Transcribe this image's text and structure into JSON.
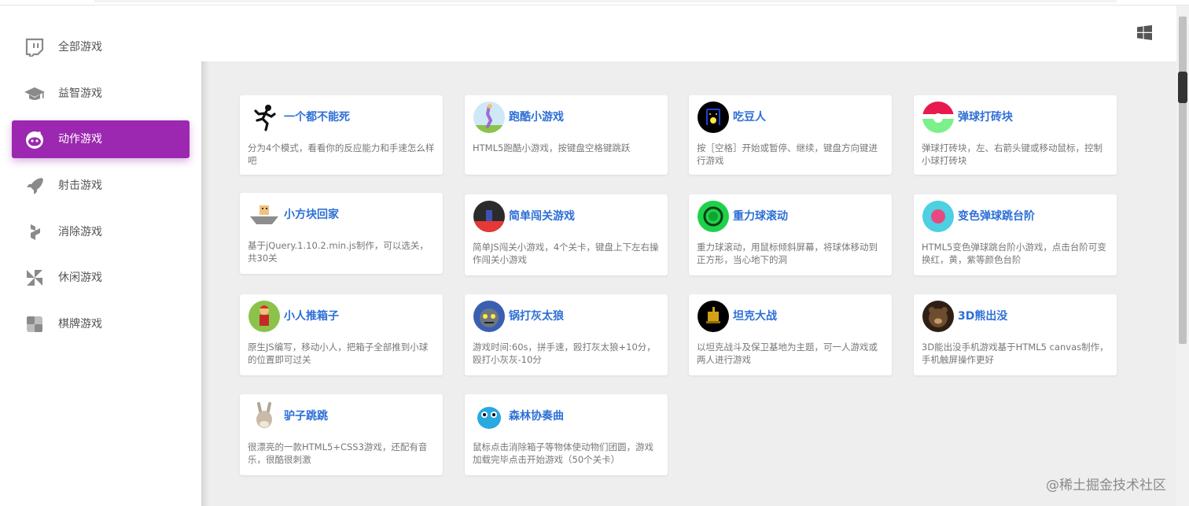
{
  "sidebar": {
    "items": [
      {
        "label": "全部游戏",
        "icon": "twitch-icon",
        "active": false
      },
      {
        "label": "益智游戏",
        "icon": "graduation-cap-icon",
        "active": false
      },
      {
        "label": "动作游戏",
        "icon": "reddit-icon",
        "active": true
      },
      {
        "label": "射击游戏",
        "icon": "rocket-icon",
        "active": false
      },
      {
        "label": "消除游戏",
        "icon": "hubspot-icon",
        "active": false
      },
      {
        "label": "休闲游戏",
        "icon": "pinwheel-icon",
        "active": false
      },
      {
        "label": "棋牌游戏",
        "icon": "board-icon",
        "active": false
      }
    ]
  },
  "header": {
    "right_icon": "windows-icon"
  },
  "colors": {
    "accent": "#9c27b0",
    "title": "#2d6fd6",
    "text": "#777777",
    "background": "#eeeeee"
  },
  "games": [
    {
      "title": "一个都不能死",
      "desc": "分为4个模式，看看你的反应能力和手速怎么样吧",
      "icon": "running-man-icon"
    },
    {
      "title": "跑酷小游戏",
      "desc": "HTML5跑酷小游戏，按键盘空格键跳跃",
      "icon": "parkour-icon"
    },
    {
      "title": "吃豆人",
      "desc": "按［空格］开始或暂停、继续，键盘方向键进行游戏",
      "icon": "pacman-icon"
    },
    {
      "title": "弹球打砖块",
      "desc": "弹球打砖块，左、右箭头键或移动鼠标，控制小球打砖块",
      "icon": "breakout-icon"
    },
    {
      "title": "小方块回家",
      "desc": "基于jQuery.1.10.2.min.js制作，可以选关，共30关",
      "icon": "block-home-icon"
    },
    {
      "title": "简单闯关游戏",
      "desc": "简单JS闯关小游戏，4个关卡，键盘上下左右操作闯关小游戏",
      "icon": "simple-level-icon"
    },
    {
      "title": "重力球滚动",
      "desc": "重力球滚动，用鼠标倾斜屏幕，将球体移动到正方形，当心地下的洞",
      "icon": "gravity-ball-icon"
    },
    {
      "title": "变色弹球跳台阶",
      "desc": "HTML5变色弹球跳台阶小游戏，点击台阶可变换红，黄，紫等颜色台阶",
      "icon": "color-ball-icon"
    },
    {
      "title": "小人推箱子",
      "desc": "原生JS编写，移动小人，把箱子全部推到小球的位置即可过关",
      "icon": "sokoban-icon"
    },
    {
      "title": "锅打灰太狼",
      "desc": "游戏时间:60s，拼手速，殴打灰太狼+10分，殴打小灰灰-10分",
      "icon": "wolf-icon"
    },
    {
      "title": "坦克大战",
      "desc": "以坦克战斗及保卫基地为主题，可一人游戏或两人进行游戏",
      "icon": "tank-icon"
    },
    {
      "title": "3D熊出没",
      "desc": "3D能出没手机游戏基于HTML5 canvas制作，手机触屏操作更好",
      "icon": "bear-icon"
    },
    {
      "title": "驴子跳跳",
      "desc": "很漂亮的一款HTML5+CSS3游戏，还配有音乐，很酷很刺激",
      "icon": "donkey-icon"
    },
    {
      "title": "森林协奏曲",
      "desc": "鼠标点击消除箱子等物体使动物们团圆，游戏加载完毕点击开始游戏（50个关卡）",
      "icon": "forest-icon"
    }
  ],
  "watermark": "@稀土掘金技术社区"
}
